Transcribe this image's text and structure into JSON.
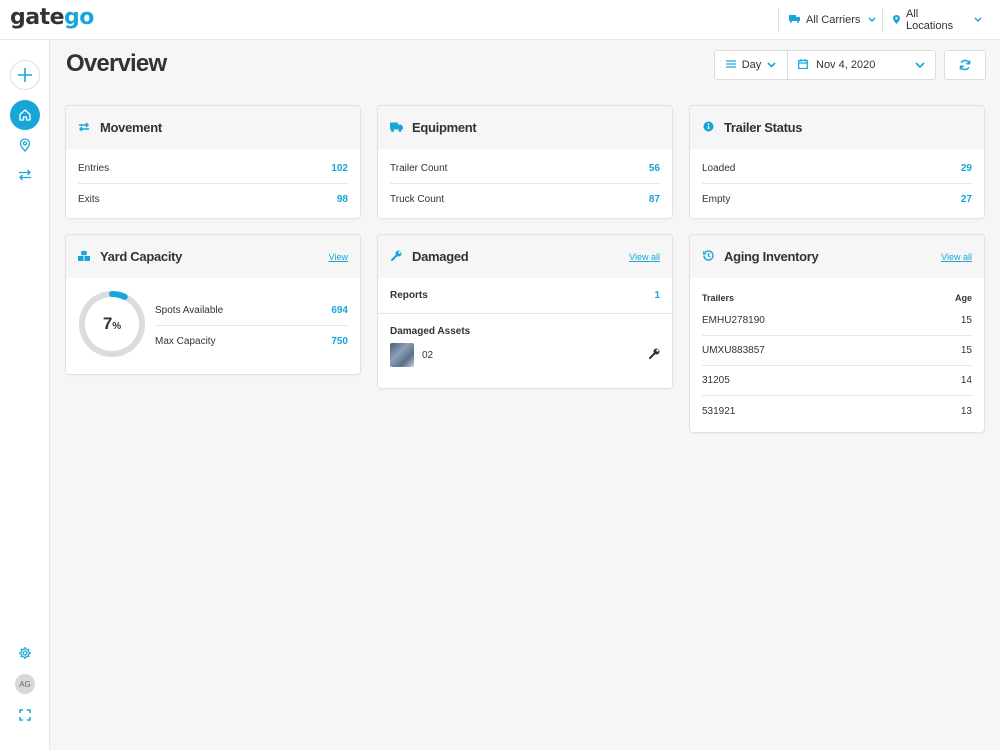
{
  "app": {
    "logo_part1": "gate",
    "logo_part2": "go",
    "accent": "#17a6d8"
  },
  "topbar": {
    "carriers_label": "All Carriers",
    "locations_label": "All Locations",
    "carriers_icon": "truck-icon",
    "locations_icon": "location-pin-icon"
  },
  "sidebar": {
    "avatar_initials": "AG",
    "items": [
      "add-icon",
      "home-icon",
      "location-icon",
      "movement-icon",
      "settings-icon",
      "fullscreen-icon"
    ]
  },
  "page": {
    "title": "Overview",
    "period_label": "Day",
    "date_value": "Nov 4, 2020"
  },
  "cards": {
    "movement": {
      "title": "Movement",
      "rows": [
        {
          "label": "Entries",
          "value": "102"
        },
        {
          "label": "Exits",
          "value": "98"
        }
      ]
    },
    "equipment": {
      "title": "Equipment",
      "rows": [
        {
          "label": "Trailer Count",
          "value": "56"
        },
        {
          "label": "Truck Count",
          "value": "87"
        }
      ]
    },
    "trailer_status": {
      "title": "Trailer Status",
      "rows": [
        {
          "label": "Loaded",
          "value": "29"
        },
        {
          "label": "Empty",
          "value": "27"
        }
      ]
    },
    "yard_capacity": {
      "title": "Yard Capacity",
      "link": "View",
      "percent": "7",
      "percent_unit": "%",
      "percent_fraction": 0.07,
      "rows": [
        {
          "label": "Spots Available",
          "value": "694"
        },
        {
          "label": "Max Capacity",
          "value": "750"
        }
      ]
    },
    "damaged": {
      "title": "Damaged",
      "link": "View all",
      "reports_label": "Reports",
      "reports_value": "1",
      "assets_label": "Damaged Assets",
      "asset_id": "02"
    },
    "aging": {
      "title": "Aging Inventory",
      "link": "View all",
      "col_trailers": "Trailers",
      "col_age": "Age",
      "rows": [
        {
          "label": "EMHU278190",
          "value": "15"
        },
        {
          "label": "UMXU883857",
          "value": "15"
        },
        {
          "label": "31205",
          "value": "14"
        },
        {
          "label": "531921",
          "value": "13"
        }
      ]
    }
  }
}
